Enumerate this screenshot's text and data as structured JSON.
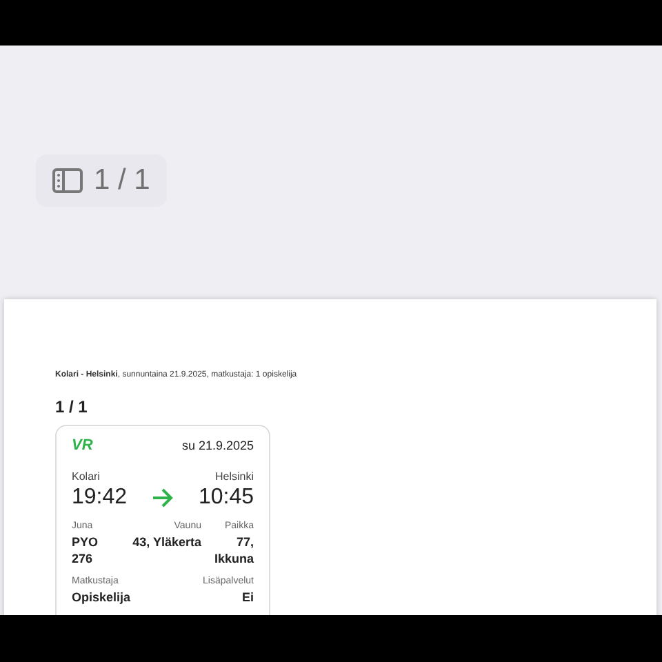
{
  "page_indicator": "1 / 1",
  "document": {
    "summary": "**Kolari - Helsinki**, sunnuntaina 21.9.2025, matkustaja: 1 opiskelija",
    "heading": "1 / 1",
    "ticket": {
      "logo": "VR",
      "date": "su 21.9.2025",
      "from": "Kolari",
      "to": "Helsinki",
      "departure": "19:42",
      "arrival": "10:45",
      "fields": [
        {
          "label": "Juna",
          "value": "PYO 276"
        },
        {
          "label": "Vaunu",
          "value": "43, Yläkerta"
        },
        {
          "label": "Paikka",
          "value": "77, Ikkuna"
        },
        {
          "label": "Matkustaja",
          "value": "Opiskelija"
        },
        {
          "label": "Lisäpalvelut",
          "value": "Ei"
        }
      ]
    }
  }
}
